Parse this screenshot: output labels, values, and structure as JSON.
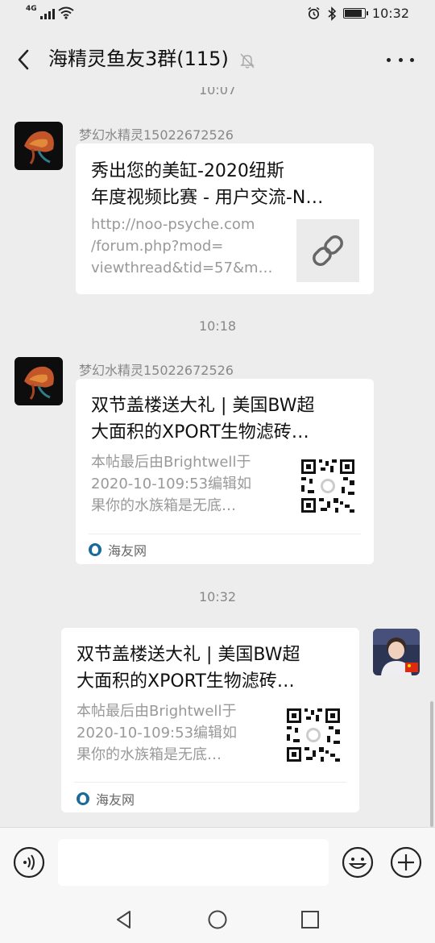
{
  "status_bar": {
    "network": "4G",
    "time": "10:32",
    "battery_level": 0.9
  },
  "header": {
    "title": "海精灵鱼友3群(115)"
  },
  "messages": [
    {
      "time": "10:07",
      "sender": "梦幻水精灵15022672526",
      "card": {
        "title": "秀出您的美缸-2020纽斯\n年度视频比赛 - 用户交流-N…",
        "description": "http://noo-psyche.com\n/forum.php?mod=\nviewthread&tid=57&m…",
        "thumb_icon": "link-icon"
      }
    },
    {
      "time": "10:18",
      "sender": "梦幻水精灵15022672526",
      "card": {
        "title": "双节盖楼送大礼 | 美国BW超\n大面积的XPORT生物滤砖…",
        "description": "本帖最后由Brightwell于\n2020-10-109:53编辑如\n果你的水族箱是无底…",
        "thumb_icon": "qr-code",
        "source": "海友网"
      }
    },
    {
      "time": "10:32",
      "sender": "",
      "card": {
        "title": "双节盖楼送大礼 | 美国BW超\n大面积的XPORT生物滤砖…",
        "description": "本帖最后由Brightwell于\n2020-10-109:53编辑如\n果你的水族箱是无底…",
        "thumb_icon": "qr-code",
        "source": "海友网"
      }
    }
  ],
  "input_bar": {
    "placeholder": ""
  },
  "colors": {
    "background": "#ededed",
    "card": "#ffffff",
    "muted_text": "#888888",
    "source_icon": "#1a6a9c"
  }
}
